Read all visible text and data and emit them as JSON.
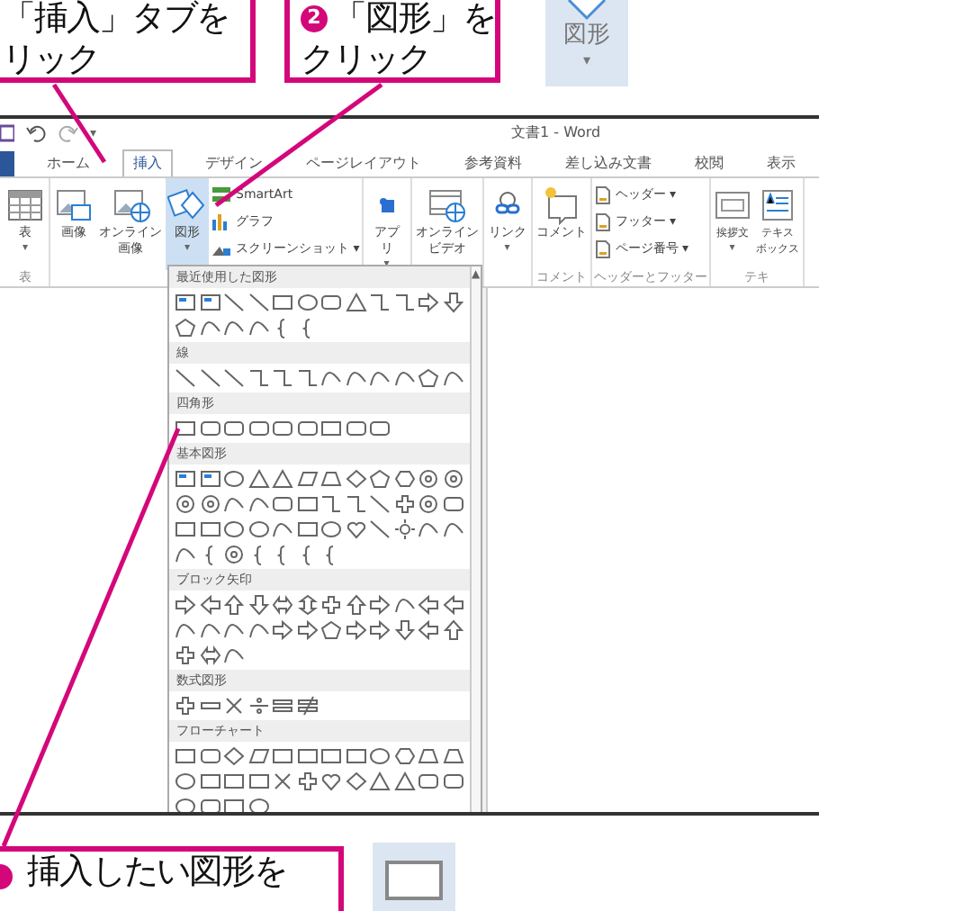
{
  "callouts": [
    {
      "kind": "top",
      "lines": [
        "「挿入」タブを",
        "リック"
      ]
    },
    {
      "kind": "top",
      "number": "2",
      "lines": [
        "「図形」を",
        "クリック"
      ]
    },
    {
      "kind": "bottom",
      "lines": [
        "挿入したい図形を"
      ]
    }
  ],
  "closeups": [
    {
      "kind": "shape-button",
      "label": "図形",
      "caret": "▾"
    },
    {
      "kind": "rectangle"
    }
  ],
  "word": {
    "title": "文書1 - Word",
    "quick_access_caret": "▾",
    "tabs": [
      {
        "label": "ホーム",
        "selected": false
      },
      {
        "label": "挿入",
        "selected": true
      },
      {
        "label": "デザイン",
        "selected": false
      },
      {
        "label": "ページレイアウト",
        "selected": false
      },
      {
        "label": "参考資料",
        "selected": false
      },
      {
        "label": "差し込み文書",
        "selected": false
      },
      {
        "label": "校閲",
        "selected": false
      },
      {
        "label": "表示",
        "selected": false
      }
    ],
    "ribbon": [
      {
        "label": "表",
        "items": [
          {
            "kind": "large",
            "lines": [
              "表"
            ],
            "caret": "▾"
          }
        ]
      },
      {
        "items": [
          {
            "kind": "large",
            "lines": [
              "画像"
            ]
          },
          {
            "kind": "large",
            "lines": [
              "オンライン",
              "画像"
            ]
          },
          {
            "kind": "large",
            "lines": [
              "図形"
            ],
            "caret": "▾",
            "selected": true
          },
          {
            "kind": "column",
            "entries": [
              {
                "label": "SmartArt"
              },
              {
                "label": "グラフ"
              },
              {
                "label": "スクリーンショット",
                "caret": "▾"
              }
            ]
          }
        ]
      },
      {
        "items": [
          {
            "kind": "large",
            "lines": [
              "アプ",
              "リ"
            ],
            "caret": "▾"
          }
        ]
      },
      {
        "items": [
          {
            "kind": "large",
            "lines": [
              "オンライン",
              "ビデオ"
            ]
          }
        ]
      },
      {
        "items": [
          {
            "kind": "large",
            "lines": [
              "リンク"
            ],
            "caret": "▾"
          }
        ]
      },
      {
        "label": "コメント",
        "items": [
          {
            "kind": "large",
            "lines": [
              "コメント"
            ]
          }
        ]
      },
      {
        "label": "ヘッダーとフッター",
        "items": [
          {
            "kind": "column",
            "entries": [
              {
                "label": "ヘッダー",
                "caret": "▾"
              },
              {
                "label": "フッター",
                "caret": "▾"
              },
              {
                "label": "ページ番号",
                "caret": "▾"
              }
            ]
          }
        ]
      },
      {
        "label": "テキ",
        "items": [
          {
            "kind": "large",
            "lines": [
              "挨拶文"
            ],
            "caret": "▾"
          },
          {
            "kind": "large",
            "lines": [
              "テキス",
              "ボックス"
            ]
          }
        ]
      }
    ],
    "gallery": {
      "scroll_up": "▲",
      "sections": [
        {
          "title": "最近使用した図形"
        },
        {
          "title": "線"
        },
        {
          "title": "四角形"
        },
        {
          "title": "基本図形"
        },
        {
          "title": "ブロック矢印"
        },
        {
          "title": "数式図形"
        },
        {
          "title": "フローチャート"
        }
      ]
    }
  }
}
